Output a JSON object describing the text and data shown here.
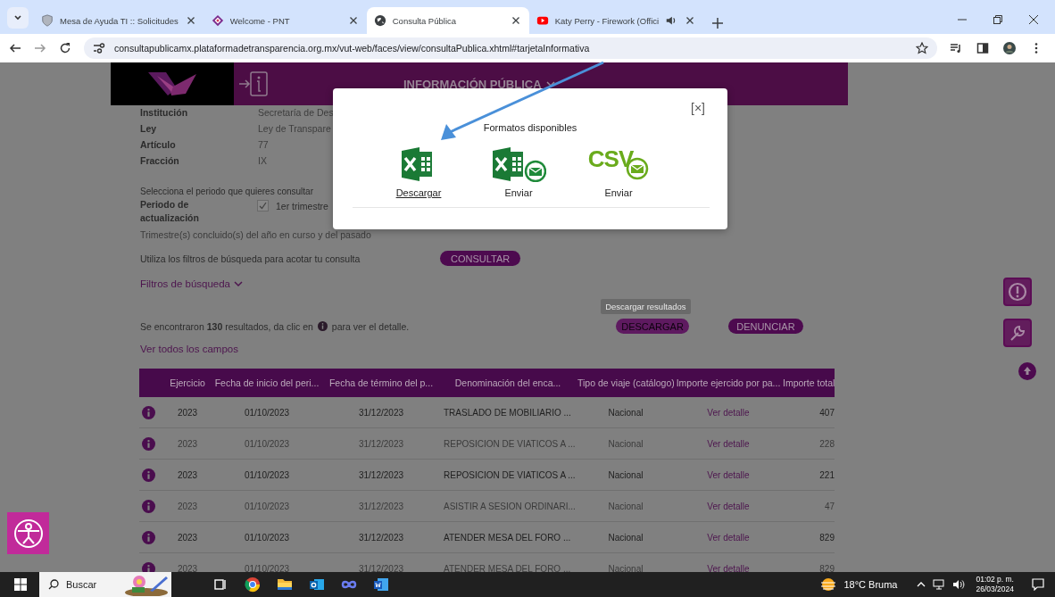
{
  "browser": {
    "tabs": [
      {
        "kind": "shield",
        "title": "Mesa de Ayuda TI :: Solicitudes",
        "selected": false,
        "audio": false
      },
      {
        "kind": "pnt",
        "title": "Welcome - PNT",
        "selected": false,
        "audio": false
      },
      {
        "kind": "globe",
        "title": "Consulta Pública",
        "selected": true,
        "audio": false
      },
      {
        "kind": "video",
        "title": "Katy Perry - Firework (Offici",
        "selected": false,
        "audio": true
      }
    ],
    "url": "consultapublicamx.plataformadetransparencia.org.mx/vut-web/faces/view/consultaPublica.xhtml#tarjetaInformativa"
  },
  "header": {
    "title": "INFORMACIÓN PÚBLICA"
  },
  "details": [
    {
      "label": "Institución",
      "value": "Secretaría de Des"
    },
    {
      "label": "Ley",
      "value": "Ley de Transpare"
    },
    {
      "label": "Artículo",
      "value": "77"
    },
    {
      "label": "Fracción",
      "value": "IX"
    }
  ],
  "period": {
    "prompt": "Selecciona el periodo que quieres consultar",
    "label": "Periodo de actualización",
    "options": [
      {
        "label": "1er trimestre",
        "checked": true
      }
    ],
    "note": "Trimestre(s) concluido(s) del año en curso y del pasado"
  },
  "filters": {
    "prompt": "Utiliza los filtros de búsqueda para acotar tu consulta",
    "button": "CONSULTAR",
    "toggle": "Filtros de búsqueda"
  },
  "results": {
    "summary_before": "Se encontraron **130** resultados, da clic en",
    "summary_after": "para ver el detalle.",
    "download": "DESCARGAR",
    "tooltip": "Descargar resultados",
    "report": "DENUNCIAR",
    "all_fields": "Ver todos los campos"
  },
  "table": {
    "columns": [
      "Ejercicio",
      "Fecha de inicio del peri...",
      "Fecha de término del p...",
      "Denominación del enca...",
      "Tipo de viaje (catálogo)",
      "Importe ejercido por pa...",
      "Importe total"
    ],
    "rows": [
      {
        "year": "2023",
        "start": "01/10/2023",
        "end": "31/12/2023",
        "name": "TRASLADO DE MOBILIARIO ...",
        "trip": "Nacional",
        "detail": "Ver detalle",
        "total": "407"
      },
      {
        "year": "2023",
        "start": "01/10/2023",
        "end": "31/12/2023",
        "name": "REPOSICION DE VIATICOS A ...",
        "trip": "Nacional",
        "detail": "Ver detalle",
        "total": "228"
      },
      {
        "year": "2023",
        "start": "01/10/2023",
        "end": "31/12/2023",
        "name": "REPOSICION DE VIATICOS A ...",
        "trip": "Nacional",
        "detail": "Ver detalle",
        "total": "221"
      },
      {
        "year": "2023",
        "start": "01/10/2023",
        "end": "31/12/2023",
        "name": "ASISTIR A SESION ORDINARI...",
        "trip": "Nacional",
        "detail": "Ver detalle",
        "total": "47"
      },
      {
        "year": "2023",
        "start": "01/10/2023",
        "end": "31/12/2023",
        "name": "ATENDER MESA DEL FORO ...",
        "trip": "Nacional",
        "detail": "Ver detalle",
        "total": "829"
      },
      {
        "year": "2023",
        "start": "01/10/2023",
        "end": "31/12/2023",
        "name": "ATENDER MESA DEL FORO ...",
        "trip": "Nacional",
        "detail": "Ver detalle",
        "total": "829"
      }
    ]
  },
  "modal": {
    "title": "Formatos disponibles",
    "close": "[×]",
    "options": [
      {
        "kind": "excel",
        "label": "Descargar",
        "focused": true
      },
      {
        "kind": "excel-mail",
        "label": "Enviar",
        "focused": false
      },
      {
        "kind": "csv-mail",
        "icon_text": "CSV",
        "label": "Enviar",
        "focused": false
      }
    ]
  },
  "taskbar": {
    "search": "Buscar",
    "weather": "18°C Bruma",
    "time": "01:02 p. m.",
    "date": "26/03/2024"
  }
}
